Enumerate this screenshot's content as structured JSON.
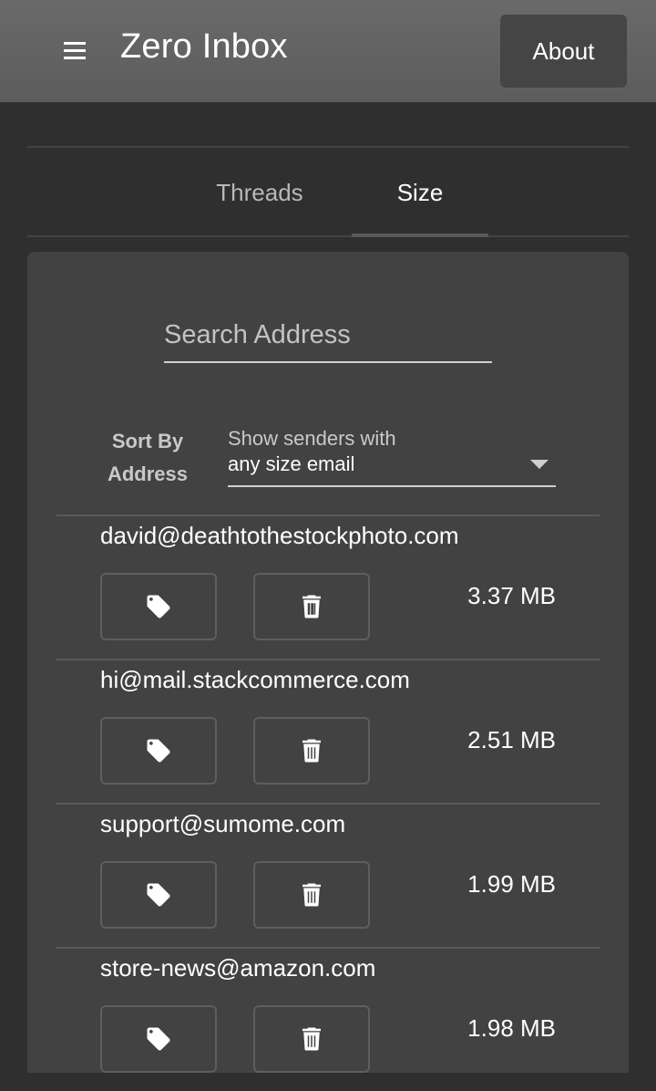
{
  "header": {
    "title": "Zero Inbox",
    "about_label": "About"
  },
  "tabs": [
    {
      "label": "Threads",
      "active": false
    },
    {
      "label": "Size",
      "active": true
    }
  ],
  "search": {
    "placeholder": "Search Address",
    "value": ""
  },
  "sort": {
    "label": "Sort By Address"
  },
  "filter": {
    "label": "Show senders with",
    "selected": "any size email"
  },
  "senders": [
    {
      "email": "david@deathtothestockphoto.com",
      "size": "3.37 MB"
    },
    {
      "email": "hi@mail.stackcommerce.com",
      "size": "2.51 MB"
    },
    {
      "email": "support@sumome.com",
      "size": "1.99 MB"
    },
    {
      "email": "store-news@amazon.com",
      "size": "1.98 MB"
    }
  ],
  "icons": {
    "menu": "hamburger-icon",
    "label": "tag-icon",
    "delete": "trash-icon",
    "dropdown": "caret-down-icon"
  }
}
